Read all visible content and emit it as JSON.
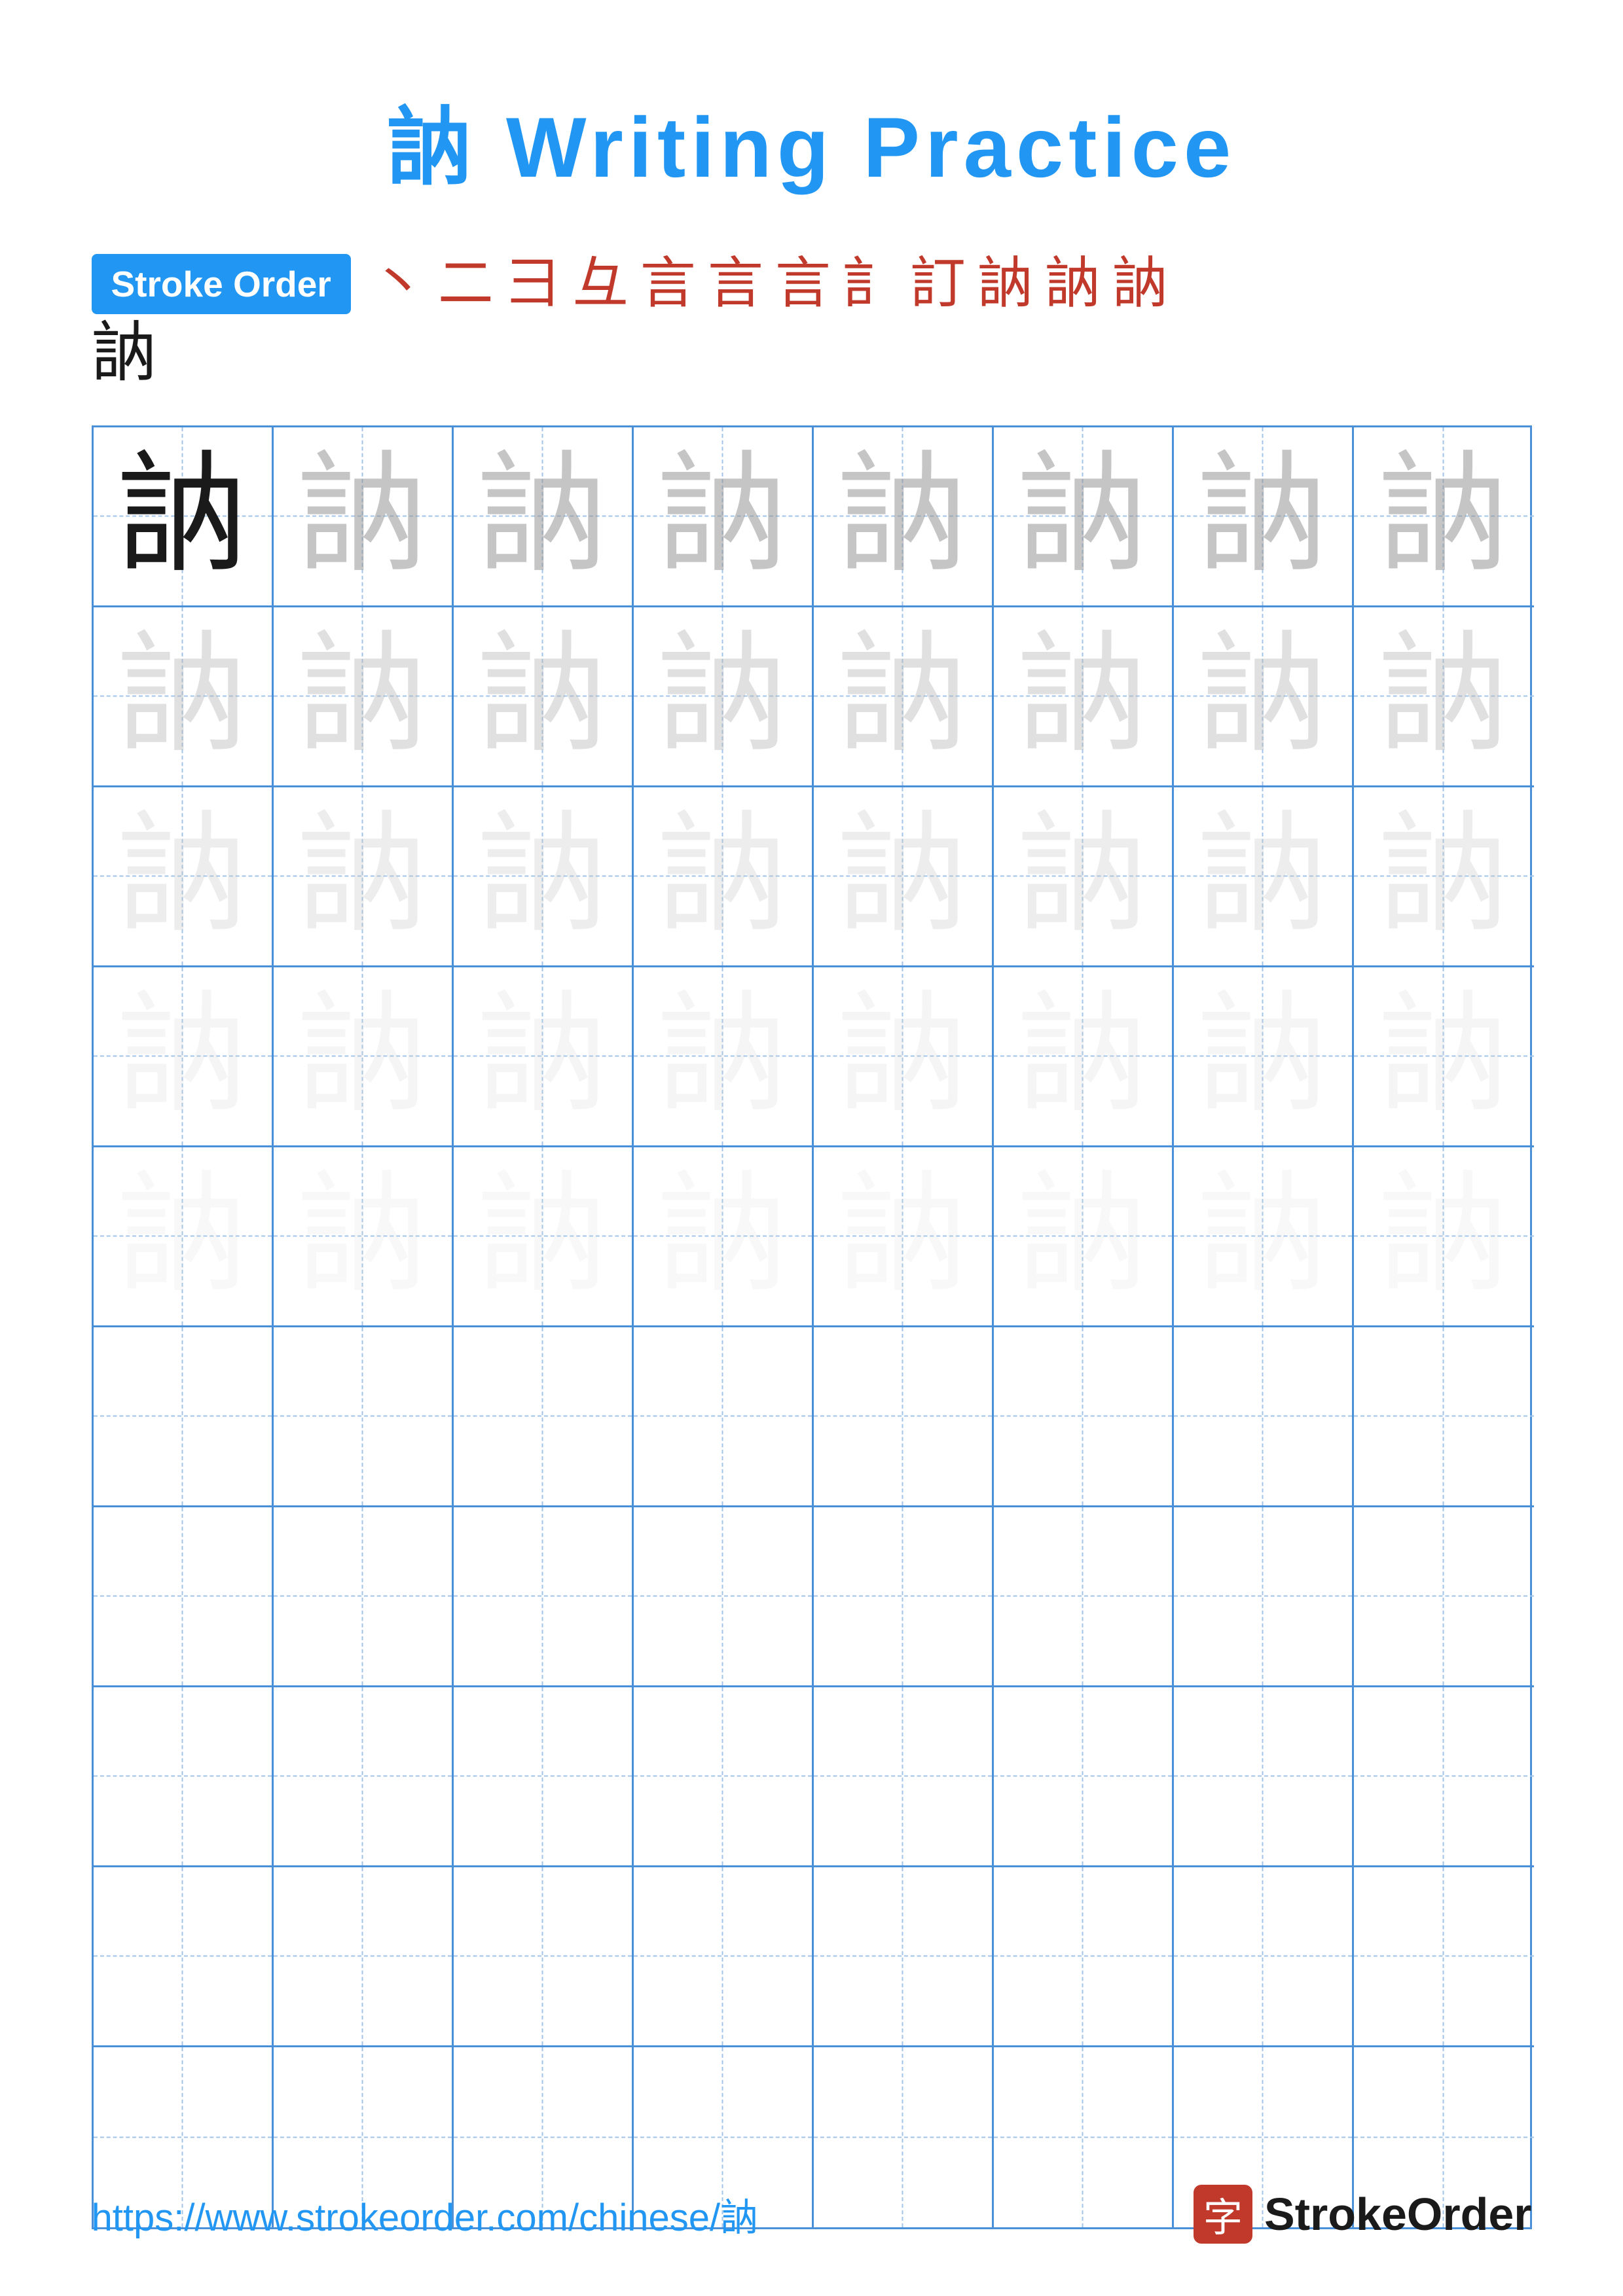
{
  "title": "訥 Writing Practice",
  "stroke_order_label": "Stroke Order",
  "stroke_chars": [
    "丶",
    "二",
    "三",
    "三",
    "言",
    "言",
    "言",
    "訁",
    "訂",
    "訥",
    "訥",
    "訥",
    "訥"
  ],
  "main_char": "訥",
  "grid_rows": 10,
  "grid_cols": 8,
  "fade_levels": [
    "dark",
    "fade1",
    "fade1",
    "fade1",
    "fade1",
    "fade1",
    "fade1",
    "fade1",
    "fade2",
    "fade2",
    "fade2",
    "fade2",
    "fade2",
    "fade2",
    "fade2",
    "fade2",
    "fade3",
    "fade3",
    "fade3",
    "fade3",
    "fade3",
    "fade3",
    "fade3",
    "fade3",
    "fade4",
    "fade4",
    "fade4",
    "fade4",
    "fade4",
    "fade4",
    "fade4",
    "fade4",
    "fade4",
    "fade4",
    "fade4",
    "fade4",
    "fade4",
    "fade4",
    "fade4",
    "fade4"
  ],
  "footer_url": "https://www.strokeorder.com/chinese/訥",
  "logo_char": "字",
  "logo_name": "StrokeOrder"
}
